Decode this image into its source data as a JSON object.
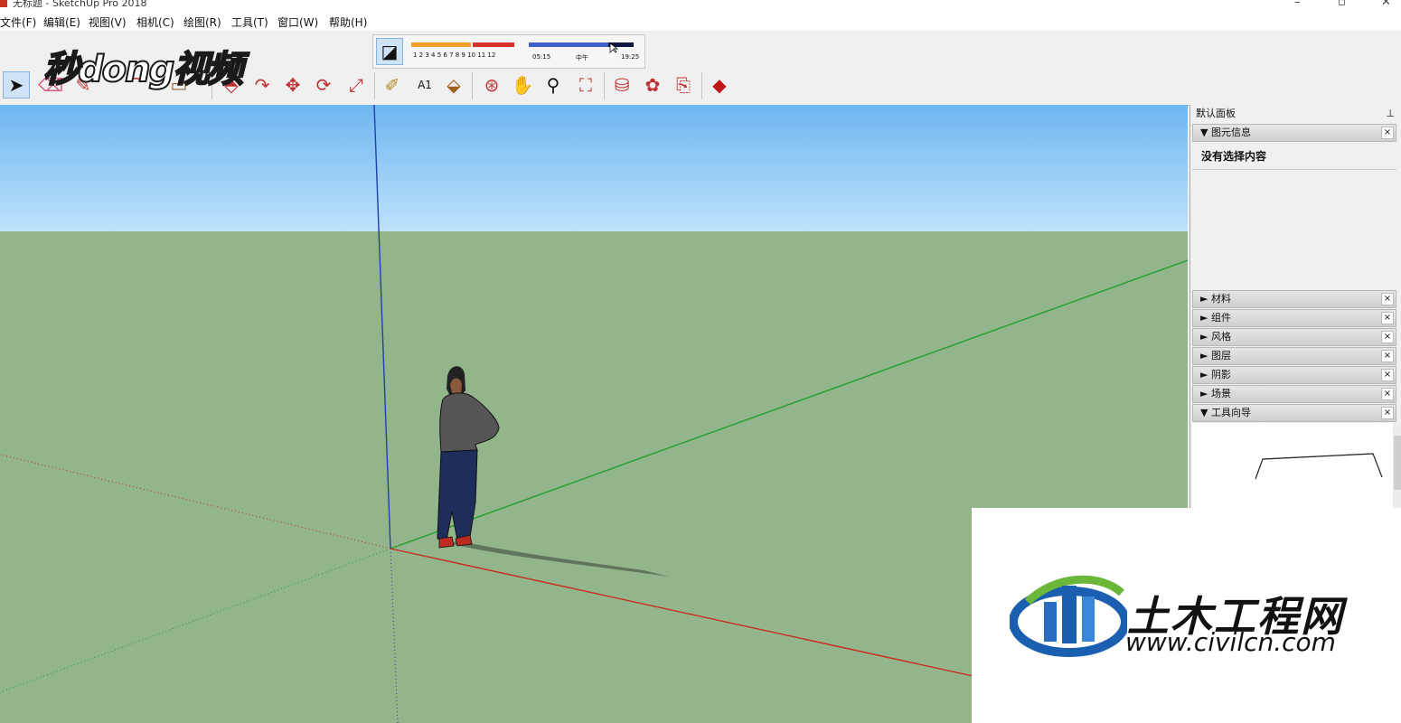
{
  "window": {
    "title": "无标题 - SketchUp Pro 2018"
  },
  "menu": [
    "文件(F)",
    "编辑(E)",
    "视图(V)",
    "相机(C)",
    "绘图(R)",
    "工具(T)",
    "窗口(W)",
    "帮助(H)"
  ],
  "shadow_bar": {
    "months": "1 2 3 4 5 6 7 8 9 10 11 12",
    "time_start": "05:15",
    "time_mid": "中午",
    "time_end": "19:25"
  },
  "watermark_top": "秒dong视频",
  "tray": {
    "title": "默认面板",
    "panels": [
      {
        "label": "▼ 图元信息"
      },
      {
        "label": "► 材料"
      },
      {
        "label": "► 组件"
      },
      {
        "label": "► 风格"
      },
      {
        "label": "► 图层"
      },
      {
        "label": "► 阴影"
      },
      {
        "label": "► 场景"
      },
      {
        "label": "▼ 工具向导"
      }
    ],
    "entity_info_message": "没有选择内容"
  },
  "watermark_bottom": {
    "cn": "土木工程网",
    "url": "www.civilcn.com"
  },
  "colors": {
    "sky": "#7cc3f6",
    "ground": "#93b58c",
    "axis_red": "#cc2a1e",
    "axis_green": "#22a02c",
    "axis_blue": "#2040b0"
  },
  "icons": [
    "select-arrow-icon",
    "eraser-icon",
    "pencil-icon",
    "arc-icon",
    "rectangle-icon",
    "push-pull-icon",
    "follow-me-icon",
    "move-icon",
    "rotate-icon",
    "scale-icon",
    "tape-measure-icon",
    "text-icon",
    "paint-bucket-icon",
    "orbit-icon",
    "pan-icon",
    "zoom-icon",
    "zoom-extents-icon",
    "warehouse-icon",
    "extension-icon",
    "send-to-layout-icon",
    "ruby-icon"
  ]
}
